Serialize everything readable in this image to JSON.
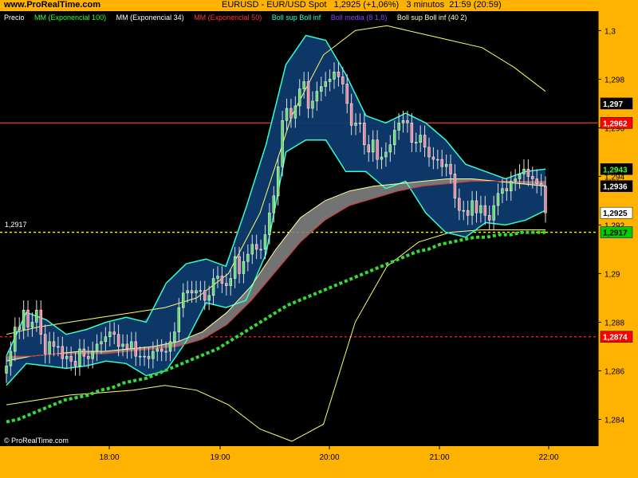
{
  "header": {
    "site": "www.ProRealTime.com",
    "title": "EURUSD - EUR/USD Spot   1,2925 (+1,06%)   3 minutos  21:59 (20:59)"
  },
  "legend": [
    {
      "text": "Precio",
      "color": "#FFFFFF"
    },
    {
      "text": "MM (Exponencial 100)",
      "color": "#33FF33"
    },
    {
      "text": "MM (Exponencial 34)",
      "color": "#FFFFFF"
    },
    {
      "text": "MM (Exponencial 50)",
      "color": "#FF3333"
    },
    {
      "text": "Boll sup Boll inf",
      "color": "#33FFCC"
    },
    {
      "text": "Boll media (8 1,8)",
      "color": "#8844FF"
    },
    {
      "text": "Boll sup Boll inf (40 2)",
      "color": "#FFFFCC"
    }
  ],
  "footer": {
    "copyright": "© ProRealTime.com"
  },
  "level_label": "1,2917",
  "chart_data": {
    "type": "line",
    "x_ticks": [
      "18:00",
      "19:00",
      "20:00",
      "21:00",
      "22:00"
    ],
    "y_ticks": [
      "1,3",
      "1,298",
      "1,296",
      "1,294",
      "1,292",
      "1,29",
      "1,288",
      "1,286",
      "1,284"
    ],
    "ylim": [
      1.2829,
      1.3008
    ],
    "price_tags": [
      {
        "text": "1,297",
        "value": 1.297,
        "bg": "#000000",
        "fg": "#FFFFFF"
      },
      {
        "text": "1,2962",
        "value": 1.2962,
        "bg": "#FF0000",
        "fg": "#FFFFFF"
      },
      {
        "text": "1,2943",
        "value": 1.2943,
        "bg": "#000000",
        "fg": "#33FF33"
      },
      {
        "text": "1,2936",
        "value": 1.2936,
        "bg": "#000000",
        "fg": "#FFFFFF"
      },
      {
        "text": "1,2925",
        "value": 1.2925,
        "bg": "#FFFFFF",
        "fg": "#000000"
      },
      {
        "text": "1,2917",
        "value": 1.2917,
        "bg": "#00CC00",
        "fg": "#000000"
      },
      {
        "text": "1,2874",
        "value": 1.2874,
        "bg": "#FF0000",
        "fg": "#FFFFFF"
      }
    ],
    "hlines": [
      {
        "value": 1.2962,
        "color": "#E03030",
        "dash": false
      },
      {
        "value": 1.2874,
        "color": "#FF2020",
        "dash": true
      },
      {
        "value": 1.2917,
        "color": "#FFFF00",
        "dash": true
      }
    ],
    "series": [
      {
        "name": "Precio",
        "closes": [
          1.2862,
          1.2868,
          1.2878,
          1.2877,
          1.2885,
          1.2878,
          1.288,
          1.2885,
          1.2875,
          1.2867,
          1.2872,
          1.287,
          1.287,
          1.2865,
          1.2866,
          1.2864,
          1.2862,
          1.2869,
          1.2866,
          1.2865,
          1.2868,
          1.2871,
          1.2872,
          1.2874,
          1.2876,
          1.2875,
          1.287,
          1.2871,
          1.2869,
          1.2872,
          1.2866,
          1.2866,
          1.2866,
          1.2865,
          1.2868,
          1.2869,
          1.2868,
          1.2868,
          1.2872,
          1.2876,
          1.2886,
          1.2892,
          1.2893,
          1.2892,
          1.2893,
          1.2893,
          1.2889,
          1.2891,
          1.2898,
          1.2899,
          1.2896,
          1.2895,
          1.2898,
          1.2907,
          1.29,
          1.2905,
          1.2908,
          1.2912,
          1.291,
          1.291,
          1.2916,
          1.2925,
          1.2932,
          1.2944,
          1.2963,
          1.2968,
          1.2964,
          1.2969,
          1.2976,
          1.2979,
          1.2968,
          1.2971,
          1.2975,
          1.2977,
          1.2979,
          1.298,
          1.2983,
          1.2981,
          1.2978,
          1.297,
          1.2961,
          1.2962,
          1.2962,
          1.2953,
          1.295,
          1.2955,
          1.2947,
          1.2948,
          1.295,
          1.2953,
          1.2959,
          1.2962,
          1.2963,
          1.2962,
          1.2954,
          1.2954,
          1.2957,
          1.2952,
          1.2948,
          1.2947,
          1.2947,
          1.2944,
          1.2945,
          1.2941,
          1.2931,
          1.2926,
          1.2926,
          1.2924,
          1.293,
          1.2925,
          1.2928,
          1.2924,
          1.2922,
          1.2928,
          1.2933,
          1.2935,
          1.2934,
          1.2938,
          1.2939,
          1.2941,
          1.2943,
          1.294,
          1.2939,
          1.2937,
          1.2936,
          1.2925
        ],
        "color": "#E88898"
      },
      {
        "name": "MM (Exponencial 100)",
        "values": [
          1.2839,
          1.284,
          1.2842,
          1.2844,
          1.2846,
          1.2848,
          1.2849,
          1.285,
          1.2852,
          1.2853,
          1.2855,
          1.2856,
          1.2857,
          1.2859,
          1.2861,
          1.2863,
          1.2865,
          1.2867,
          1.2869,
          1.2872,
          1.2875,
          1.2878,
          1.2881,
          1.2884,
          1.2887,
          1.2889,
          1.2891,
          1.2893,
          1.2895,
          1.2897,
          1.2899,
          1.2901,
          1.2903,
          1.2905,
          1.2907,
          1.2909,
          1.291,
          1.2912,
          1.2913,
          1.2914,
          1.2915,
          1.2915,
          1.2916,
          1.2916,
          1.2917,
          1.2917,
          1.2917
        ],
        "color": "#33DD33"
      },
      {
        "name": "MM (Exponencial 34)",
        "values": [
          1.2864,
          1.2866,
          1.2867,
          1.2868,
          1.2868,
          1.2869,
          1.287,
          1.2872,
          1.2876,
          1.2884,
          1.2895,
          1.291,
          1.2923,
          1.293,
          1.2934,
          1.2936,
          1.2937,
          1.2938,
          1.2939,
          1.2939,
          1.2938,
          1.2937,
          1.2936
        ],
        "color": "#FFFF99"
      },
      {
        "name": "MM (Exponencial 50)",
        "values": [
          1.2866,
          1.2866,
          1.2867,
          1.2867,
          1.2867,
          1.2868,
          1.2869,
          1.287,
          1.2873,
          1.2879,
          1.2889,
          1.2901,
          1.2913,
          1.2922,
          1.2928,
          1.2931,
          1.2934,
          1.2936,
          1.2937,
          1.2938,
          1.2938,
          1.2938,
          1.2938
        ],
        "color": "#E03030"
      },
      {
        "name": "Boll sup (8 1,8)",
        "values": [
          1.2866,
          1.2884,
          1.2881,
          1.2875,
          1.2877,
          1.288,
          1.2882,
          1.288,
          1.2896,
          1.2904,
          1.2906,
          1.2903,
          1.2927,
          1.2953,
          1.2986,
          1.2998,
          1.2996,
          1.2982,
          1.2965,
          1.2962,
          1.2966,
          1.2962,
          1.2955,
          1.2945,
          1.2942,
          1.2939,
          1.2942,
          1.2943
        ],
        "color": "#33FFCC"
      },
      {
        "name": "Boll inf (8 1,8)",
        "values": [
          1.2854,
          1.2863,
          1.2862,
          1.2861,
          1.2862,
          1.2864,
          1.2863,
          1.2858,
          1.286,
          1.2872,
          1.2888,
          1.2886,
          1.2889,
          1.2908,
          1.295,
          1.2955,
          1.2955,
          1.2942,
          1.2942,
          1.2935,
          1.2938,
          1.2925,
          1.2917,
          1.2915,
          1.2921,
          1.292,
          1.2922,
          1.2926
        ],
        "color": "#33FFCC"
      },
      {
        "name": "Boll sup (40 2)",
        "values": [
          1.2875,
          1.2878,
          1.288,
          1.2882,
          1.2884,
          1.2886,
          1.289,
          1.29,
          1.2925,
          1.2965,
          1.299,
          1.3,
          1.3002,
          1.2999,
          1.2996,
          1.2993,
          1.2985,
          1.2975
        ],
        "color": "#FFFF66"
      },
      {
        "name": "Boll inf (40 2)",
        "values": [
          1.2846,
          1.2848,
          1.285,
          1.2851,
          1.2852,
          1.2854,
          1.2852,
          1.2846,
          1.2836,
          1.2831,
          1.2838,
          1.288,
          1.2903,
          1.2913,
          1.2917,
          1.2918,
          1.2918,
          1.2918
        ],
        "color": "#FFFF66"
      }
    ]
  }
}
